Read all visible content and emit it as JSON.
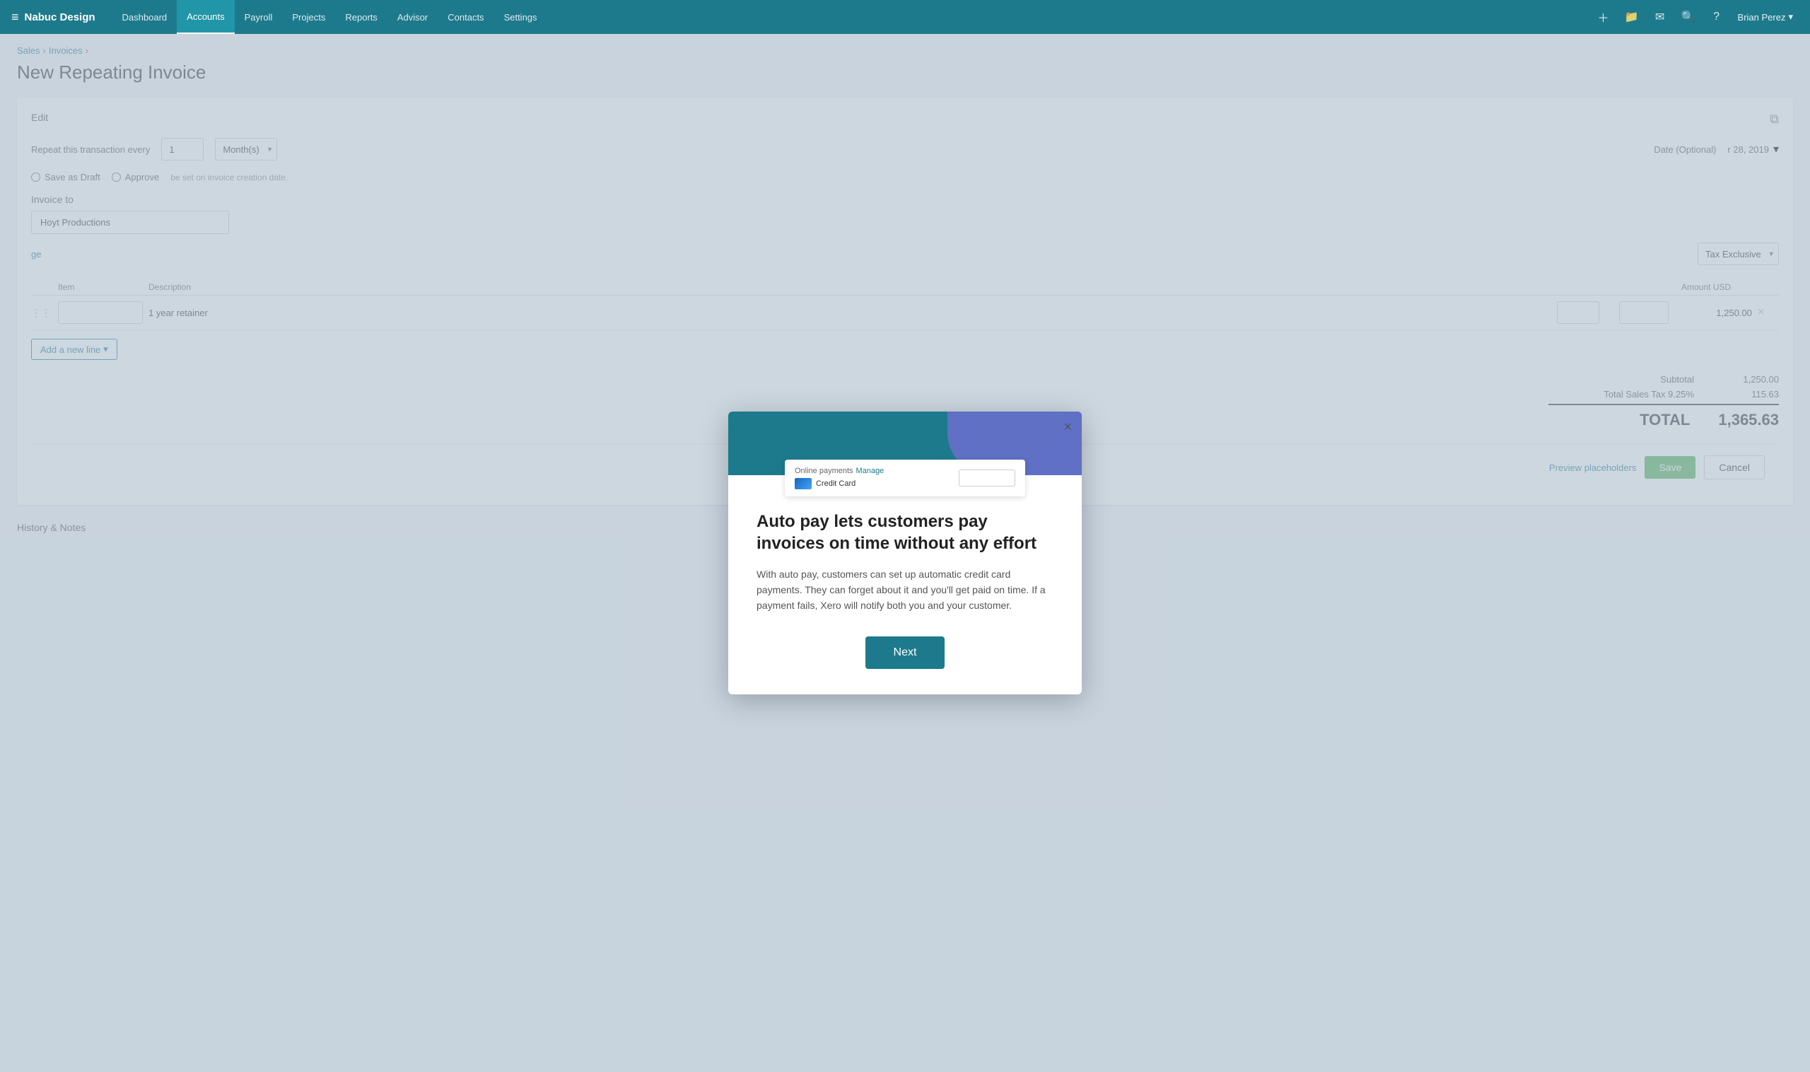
{
  "app": {
    "logo": "≡",
    "company": "Nabuc Design",
    "user": "Brian Perez"
  },
  "nav": {
    "links": [
      {
        "label": "Dashboard",
        "active": false
      },
      {
        "label": "Accounts",
        "active": true
      },
      {
        "label": "Payroll",
        "active": false
      },
      {
        "label": "Projects",
        "active": false
      },
      {
        "label": "Reports",
        "active": false
      },
      {
        "label": "Advisor",
        "active": false
      },
      {
        "label": "Contacts",
        "active": false
      },
      {
        "label": "Settings",
        "active": false
      }
    ]
  },
  "breadcrumb": {
    "sales": "Sales",
    "invoices": "Invoices",
    "separator": "›"
  },
  "page": {
    "title": "New Repeating Invoice"
  },
  "form": {
    "edit_label": "Edit",
    "repeat_label": "Repeat this transaction every",
    "repeat_num": "1",
    "repeat_unit": "Month(s)",
    "save_draft": "Save as Draft",
    "approve": "Approve",
    "date_label": "Date (Optional)",
    "date_value": "r 28, 2019",
    "invoice_to_label": "Invoice to",
    "client_name": "Hoyt Productions",
    "manage_link": "ge",
    "tax_label": "Tax Exclusive",
    "table": {
      "headers": [
        "",
        "Item",
        "Description",
        "",
        "",
        "Amount USD",
        ""
      ],
      "rows": [
        {
          "item": "",
          "description": "1 year retainer",
          "amount": "1,250.00"
        }
      ]
    },
    "add_line": "Add a new line",
    "subtotal_label": "Subtotal",
    "subtotal_value": "1,250.00",
    "tax_row_label": "Total Sales Tax 9.25%",
    "tax_row_value": "115.63",
    "total_label": "TOTAL",
    "total_value": "1,365.63",
    "preview_btn": "Preview placeholders",
    "save_btn": "Save",
    "cancel_btn": "Cancel"
  },
  "modal": {
    "close_icon": "×",
    "preview": {
      "online_label": "Online payments",
      "manage_label": "Manage",
      "credit_label": "Credit Card"
    },
    "title": "Auto pay lets customers pay invoices on time without any effort",
    "description": "With auto pay, customers can set up automatic credit card payments. They can forget about it and you'll get paid on time. If a payment fails, Xero will notify both you and your customer.",
    "next_btn": "Next"
  }
}
